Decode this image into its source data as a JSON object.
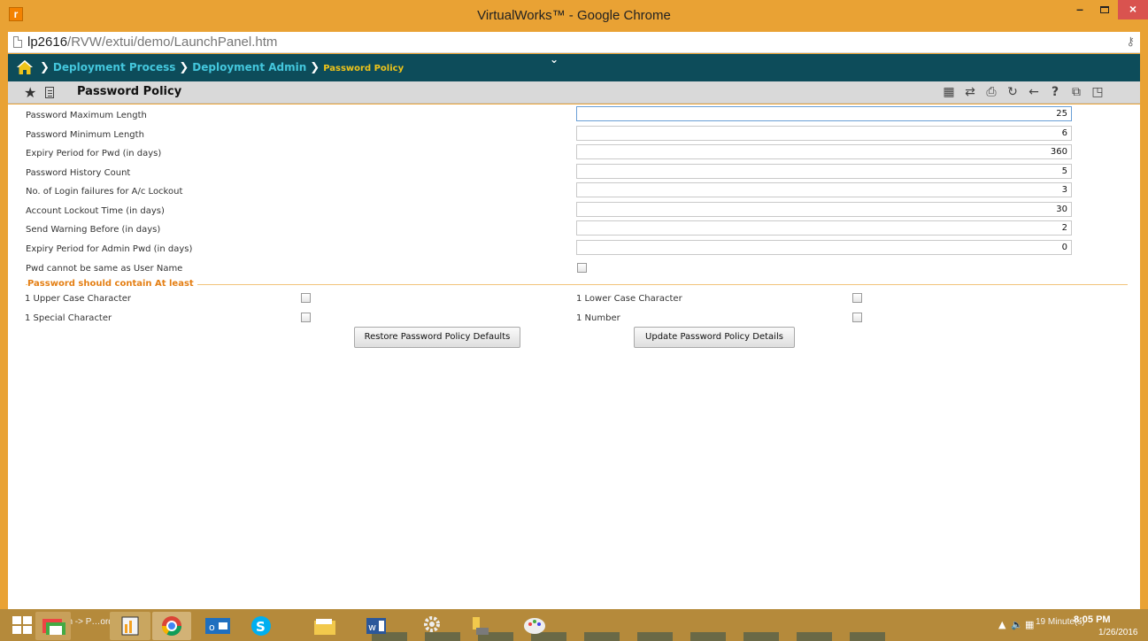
{
  "window": {
    "app_icon_letter": "r",
    "title": "VirtualWorks™ - Google Chrome",
    "minimize_glyph": "–",
    "close_glyph": "×"
  },
  "address": {
    "host": "lp2616",
    "path": "/RVW/extui/demo/LaunchPanel.htm"
  },
  "breadcrumb": {
    "items": [
      "Deployment Process",
      "Deployment Admin"
    ],
    "current": "Password Policy",
    "separator": "❯"
  },
  "panel": {
    "title": "Password Policy",
    "star_glyph": "★",
    "toolbar": [
      {
        "name": "grid-icon",
        "glyph": "▦"
      },
      {
        "name": "shuffle-icon",
        "glyph": "⇄"
      },
      {
        "name": "print-icon",
        "glyph": "⎙"
      },
      {
        "name": "repeat-icon",
        "glyph": "↻"
      },
      {
        "name": "back-arrow-icon",
        "glyph": "←"
      },
      {
        "name": "help-icon",
        "glyph": "?"
      },
      {
        "name": "window-settings-icon",
        "glyph": "⧉"
      },
      {
        "name": "restore-window-icon",
        "glyph": "◳"
      }
    ]
  },
  "fields": [
    {
      "label": "Password Maximum Length",
      "value": "25"
    },
    {
      "label": "Password Minimum Length",
      "value": "6"
    },
    {
      "label": "Expiry Period for Pwd (in days)",
      "value": "360"
    },
    {
      "label": "Password History Count",
      "value": "5"
    },
    {
      "label": "No. of Login failures for A/c Lockout",
      "value": "3"
    },
    {
      "label": "Account Lockout Time (in days)",
      "value": "30"
    },
    {
      "label": "Send Warning Before (in days)",
      "value": "2"
    },
    {
      "label": "Expiry Period for Admin Pwd (in days)",
      "value": "0"
    }
  ],
  "username_check": {
    "label": "Pwd cannot be same as User Name",
    "checked": false
  },
  "section": {
    "legend": "Password should contain At least"
  },
  "requirements": {
    "upper": {
      "label": "1 Upper Case Character",
      "checked": false
    },
    "lower": {
      "label": "1 Lower Case Character",
      "checked": false
    },
    "special": {
      "label": "1 Special Character",
      "checked": false
    },
    "number": {
      "label": "1 Number",
      "checked": false
    }
  },
  "buttons": {
    "restore": "Restore Password Policy Defaults",
    "update": "Update Password Policy Details"
  },
  "taskbar": {
    "running_label": "ymen…n -> P…ord Pol…",
    "tray_minutes": "19 Minute(s)",
    "time": "8:05 PM",
    "date": "1/26/2016"
  },
  "colors": {
    "breadcrumb_bg": "#0d4c5a",
    "breadcrumb_link": "#44c7dd",
    "breadcrumb_current": "#f0c419",
    "section_legend": "#e47f14",
    "window_frame": "#e9a234"
  }
}
